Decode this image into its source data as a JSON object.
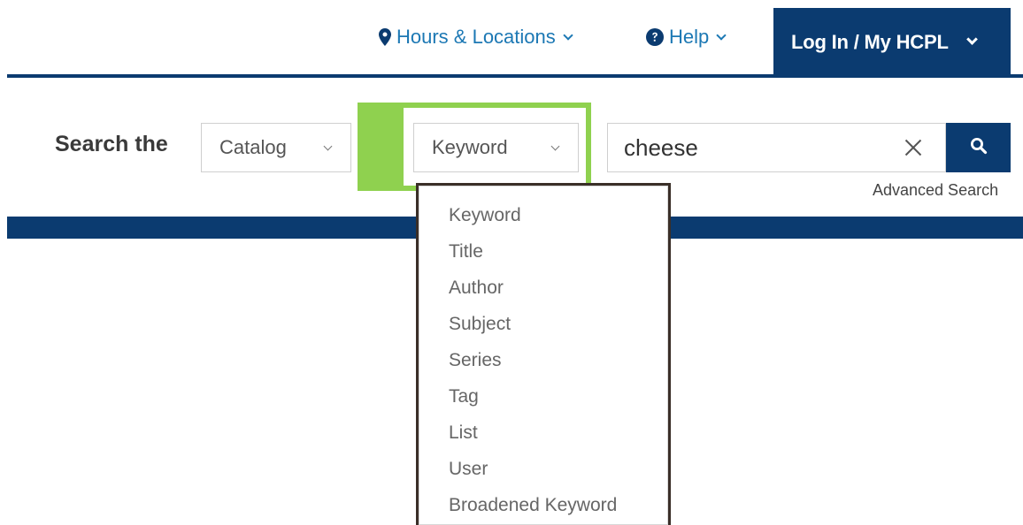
{
  "header": {
    "hours_label": "Hours & Locations",
    "help_label": "Help",
    "login_label": "Log In / My HCPL",
    "colors": {
      "brand_navy": "#0b3b70",
      "link_blue": "#1c78b4",
      "highlight_green": "#8fd14f"
    }
  },
  "search": {
    "label": "Search the",
    "scope_value": "Catalog",
    "field_value": "Keyword",
    "query_value": "cheese",
    "advanced_label": "Advanced Search"
  },
  "dropdown": {
    "items": [
      "Keyword",
      "Title",
      "Author",
      "Subject",
      "Series",
      "Tag",
      "List",
      "User",
      "Broadened Keyword"
    ]
  }
}
